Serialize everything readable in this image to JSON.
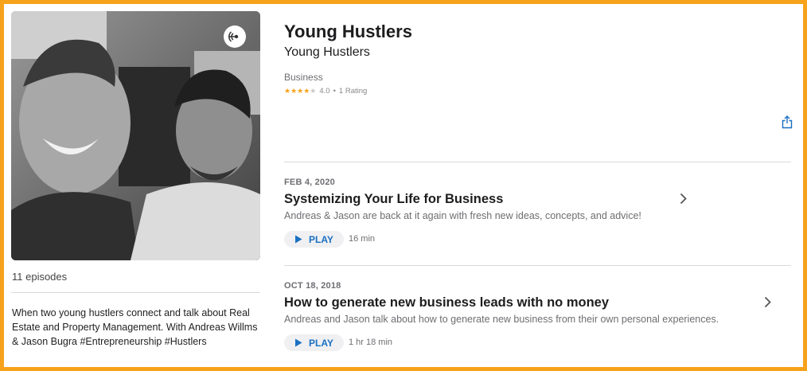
{
  "podcast": {
    "title": "Young Hustlers",
    "author": "Young Hustlers",
    "category": "Business",
    "rating_value": "4.0",
    "rating_count": "1 Rating",
    "rating_stars": 4,
    "episodes_count": "11 episodes",
    "description": "When two young hustlers connect and talk about Real Estate and Property Management. With Andreas Willms & Jason Bugra #Entrepreneurship #Hustlers"
  },
  "artwork": {
    "badge_icon": "podcast-antenna-icon"
  },
  "share": {
    "icon": "share-icon"
  },
  "episodes": [
    {
      "date": "FEB 4, 2020",
      "title": "Systemizing Your Life for Business",
      "description": "Andreas & Jason are back at it again with fresh new ideas, concepts, and advice!",
      "play_label": "PLAY",
      "duration": "16 min"
    },
    {
      "date": "OCT 18, 2018",
      "title": "How to generate new business leads with no money",
      "description": "Andreas and Jason talk about how to generate new business from their own personal experiences.",
      "play_label": "PLAY",
      "duration": "1 hr 18 min"
    }
  ],
  "colors": {
    "accent": "#1a6fc1",
    "frame": "#f7a21b",
    "star": "#f7a21b"
  }
}
